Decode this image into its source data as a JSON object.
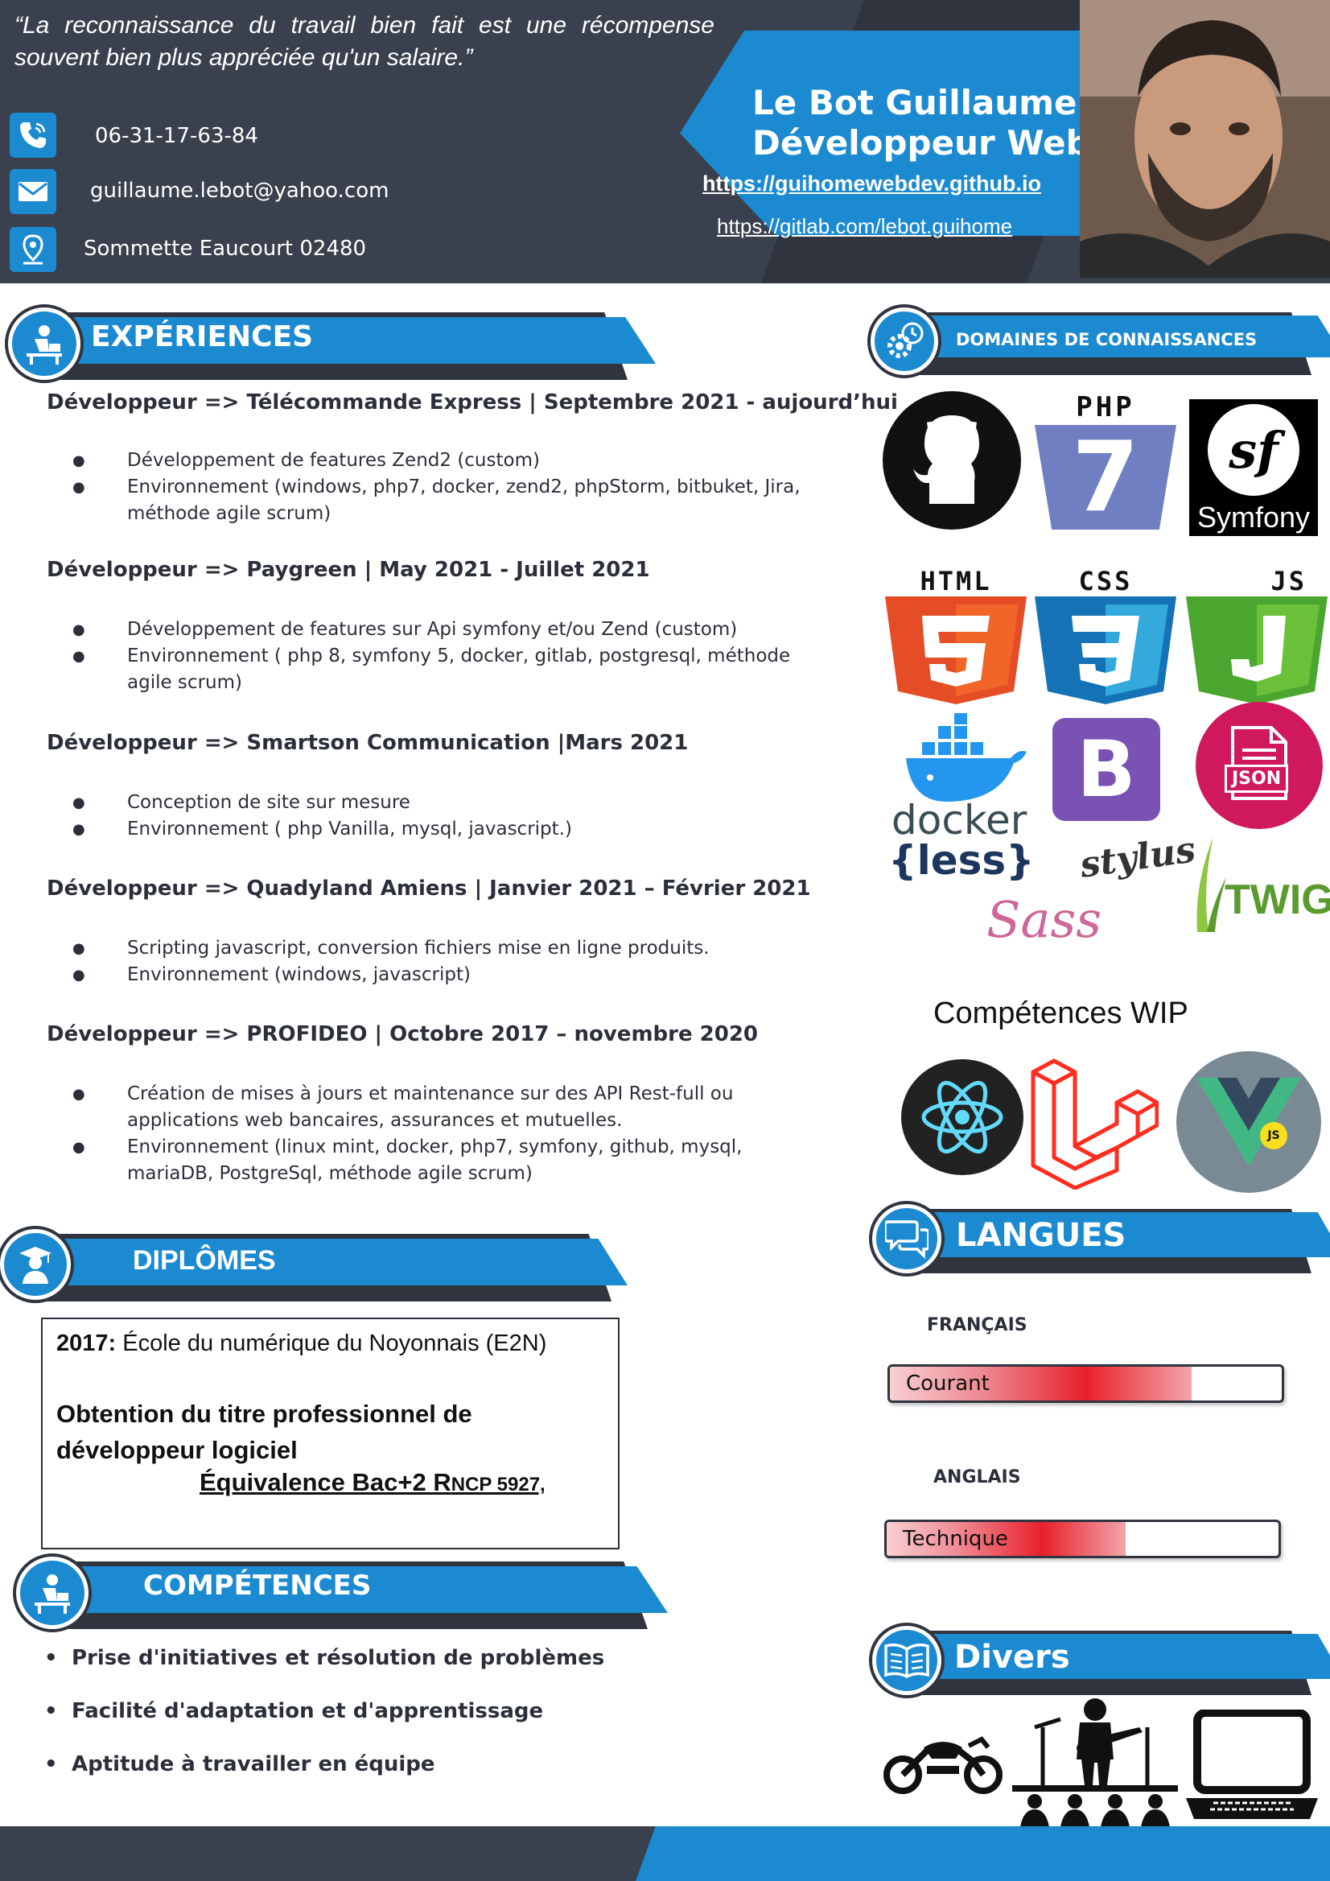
{
  "header": {
    "quote": "“La reconnaissance du travail bien fait est une récompense souvent bien plus appréciée qu'un salaire.”",
    "phone": "06-31-17-63-84",
    "email": "guillaume.lebot@yahoo.com",
    "address": "Sommette Eaucourt 02480",
    "name": "Le Bot Guillaume",
    "job_title": "Développeur Web",
    "link_portfolio": "https://guihomewebdev.github.io",
    "link_gitlab": "https://gitlab.com/lebot.guihome"
  },
  "experiences": {
    "heading": "EXPÉRIENCES",
    "jobs": [
      {
        "title": "Développeur => Télécommande Express | Septembre 2021 - aujourd’hui",
        "bullets": [
          "Développement de features Zend2 (custom)",
          "Environnement (windows, php7, docker, zend2, phpStorm, bitbuket, Jira, méthode agile scrum)"
        ]
      },
      {
        "title": "Développeur => Paygreen | May 2021 - Juillet 2021",
        "bullets": [
          "Développement de features sur Api symfony et/ou Zend (custom)",
          "Environnement ( php 8, symfony 5, docker,  gitlab, postgresql, méthode agile scrum)"
        ]
      },
      {
        "title": "Développeur => Smartson Communication |Mars 2021",
        "bullets": [
          "Conception de site sur mesure",
          "Environnement ( php Vanilla, mysql, javascript.)"
        ]
      },
      {
        "title": "Développeur => Quadyland Amiens | Janvier 2021 – Février 2021",
        "bullets": [
          " Scripting  javascript, conversion fichiers mise en ligne produits.",
          " Environnement (windows, javascript)"
        ]
      },
      {
        "title": "Développeur => PROFIDEO | Octobre 2017 – novembre 2020",
        "bullets": [
          "Création de mises à jours et maintenance sur des API Rest-full ou applications web  bancaires, assurances et mutuelles.",
          "Environnement (linux mint, docker, php7, symfony, github, mysql, mariaDB, PostgreSql, méthode agile scrum)"
        ]
      }
    ]
  },
  "diplomes": {
    "heading": "DIPLÔMES",
    "year": "2017:",
    "school": " École du numérique du Noyonnais (E2N)",
    "title": "Obtention du titre professionnel de développeur logiciel",
    "equivalence_main": "Équivalence Bac+2 R",
    "equivalence_small": "NCP 5927,"
  },
  "competences": {
    "heading": "COMPÉTENCES",
    "items": [
      "Prise d'initiatives et résolution de problèmes",
      "Facilité d'adaptation et d'apprentissage",
      "Aptitude à travailler en équipe"
    ]
  },
  "domaines": {
    "heading": "DOMAINES DE CONNAISSANCES",
    "logos": [
      "github-logo",
      "php7-logo",
      "symfony-logo",
      "html5-logo",
      "css3-logo",
      "js-logo",
      "docker-logo",
      "bootstrap-logo",
      "json-logo",
      "less-logo",
      "stylus-logo",
      "twig-logo",
      "sass-logo"
    ],
    "labels": {
      "php": "PHP",
      "php_version": "7",
      "symfony": "Symfony",
      "html": "HTML",
      "css": "CSS",
      "js": "JS",
      "docker": "docker",
      "bootstrap": "B",
      "json": "JSON",
      "less": "{less}",
      "stylus": "stylus",
      "twig": "TWIG",
      "sass": "Sass"
    }
  },
  "wip": {
    "heading": "Compétences WIP",
    "logos": [
      "react-logo",
      "laravel-logo",
      "vuejs-logo"
    ],
    "vue_badge": "JS"
  },
  "langues": {
    "heading": "LANGUES",
    "items": [
      {
        "language": "FRANÇAIS",
        "level": "Courant",
        "fill": 0.77
      },
      {
        "language": "ANGLAIS",
        "level": "Technique",
        "fill": 0.61
      }
    ]
  },
  "divers": {
    "heading": "Divers",
    "icons": [
      "motorcycle-icon",
      "guitarist-concert-icon",
      "laptop-icon"
    ]
  },
  "colors": {
    "dark": "#3a404d",
    "darker": "#2f343f",
    "blue": "#1b8ad1",
    "red": "#e8202a"
  }
}
